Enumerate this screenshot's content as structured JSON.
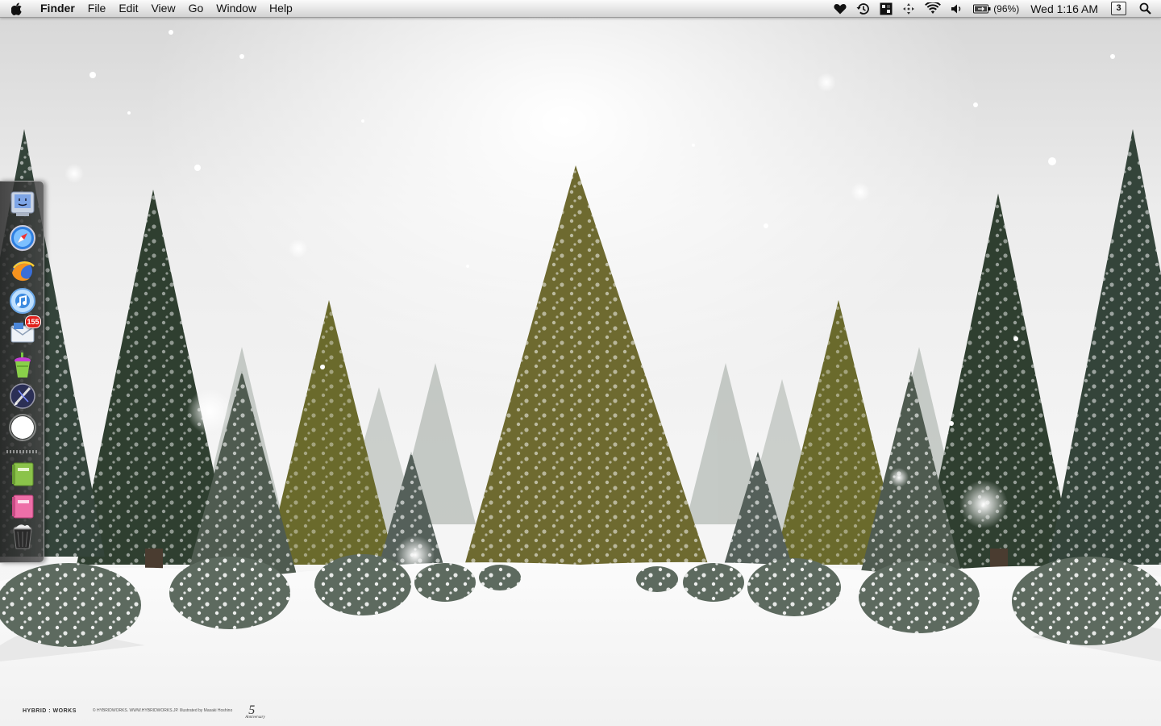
{
  "menubar": {
    "apple_icon": "apple-logo-icon",
    "app_name": "Finder",
    "menus": [
      "File",
      "Edit",
      "View",
      "Go",
      "Window",
      "Help"
    ],
    "status_icons": [
      "heart-icon",
      "time-machine-icon",
      "tiles-icon",
      "move-arrows-icon",
      "wifi-icon",
      "volume-icon",
      "battery-icon"
    ],
    "battery_percent": "(96%)",
    "clock": "Wed 1:16 AM",
    "spaces_number": "3",
    "spotlight_icon": "spotlight-search-icon"
  },
  "dock": {
    "position": "left",
    "items": [
      {
        "icon": "finder-icon"
      },
      {
        "icon": "safari-icon"
      },
      {
        "icon": "firefox-like-browser-icon"
      },
      {
        "icon": "itunes-icon"
      },
      {
        "icon": "mail-icon",
        "badge": "155"
      },
      {
        "icon": "drink-cup-app-icon"
      },
      {
        "icon": "pen-tool-app-icon"
      },
      {
        "icon": "glowing-orb-app-icon"
      },
      {
        "icon": "green-notebook-icon"
      },
      {
        "icon": "pink-notebook-icon"
      },
      {
        "icon": "trash-icon"
      }
    ]
  },
  "wallpaper": {
    "brand": "HYBRID : WORKS",
    "copyright": "© HYBRIDWORKS.  WWW.HYBRIDWORKS.JP.   Illustrated by Masaki Hoshino",
    "anniversary_number": "5",
    "anniversary_word": "Anniversary"
  },
  "colors": {
    "menubar": "#e3e3e3",
    "snow": "#f7f7f7",
    "tree_dark": "#2f3f30",
    "tree_olive": "#6f6a2a",
    "badge": "#e0201b"
  }
}
